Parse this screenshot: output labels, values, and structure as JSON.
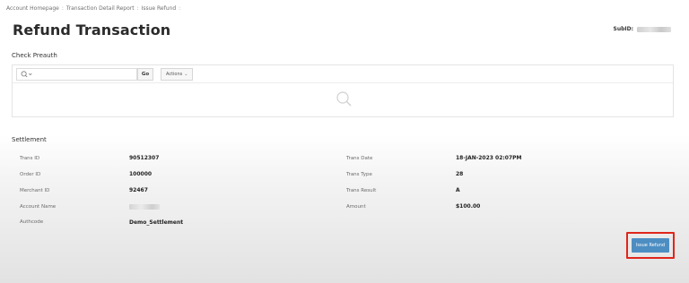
{
  "breadcrumb": {
    "items": [
      "Account Homepage",
      "Transaction Detail Report",
      "Issue Refund"
    ],
    "separator": ":"
  },
  "page": {
    "title": "Refund Transaction",
    "subid_label": "SubID:"
  },
  "preauth": {
    "title": "Check Preauth",
    "search_placeholder": "",
    "go_label": "Go",
    "actions_label": "Actions",
    "empty_state_icon": "magnifier-icon"
  },
  "settlement": {
    "title": "Settlement",
    "left_fields": [
      {
        "label": "Trans ID",
        "value": "90512307"
      },
      {
        "label": "Order ID",
        "value": "100000"
      },
      {
        "label": "Merchant ID",
        "value": "92467"
      },
      {
        "label": "Account Name",
        "value": ""
      },
      {
        "label": "Authcode",
        "value": "Demo_Settlement"
      }
    ],
    "right_fields": [
      {
        "label": "Trans Date",
        "value": "18-JAN-2023 02:07PM"
      },
      {
        "label": "Trans Type",
        "value": "28"
      },
      {
        "label": "Trans Result",
        "value": "A"
      },
      {
        "label": "Amount",
        "value": "$100.00"
      }
    ]
  },
  "actions": {
    "issue_refund_label": "Issue Refund",
    "button_color": "#4d8ec2",
    "highlight_color": "#e0261b"
  }
}
